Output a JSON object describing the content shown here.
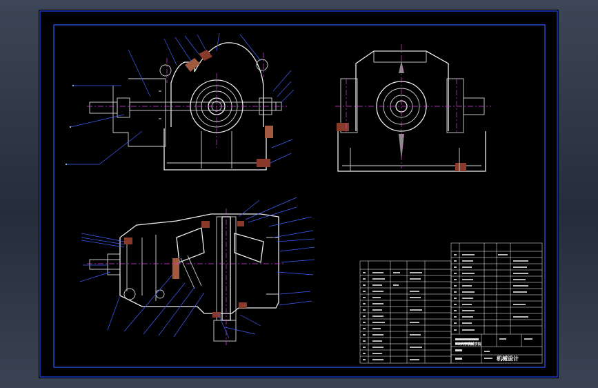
{
  "drawing": {
    "colors": {
      "background": "#000000",
      "border": "#1a3fd8",
      "geometry": "#d8d8d8",
      "centerline": "#e040e0",
      "leader": "#4060ff",
      "section_hatch": "#8a3a2a"
    },
    "views": [
      "front-view",
      "side-view",
      "plan-section-view"
    ]
  },
  "title_block": {
    "school": "XX大学机械学院",
    "drawing_title": "机械设计"
  }
}
